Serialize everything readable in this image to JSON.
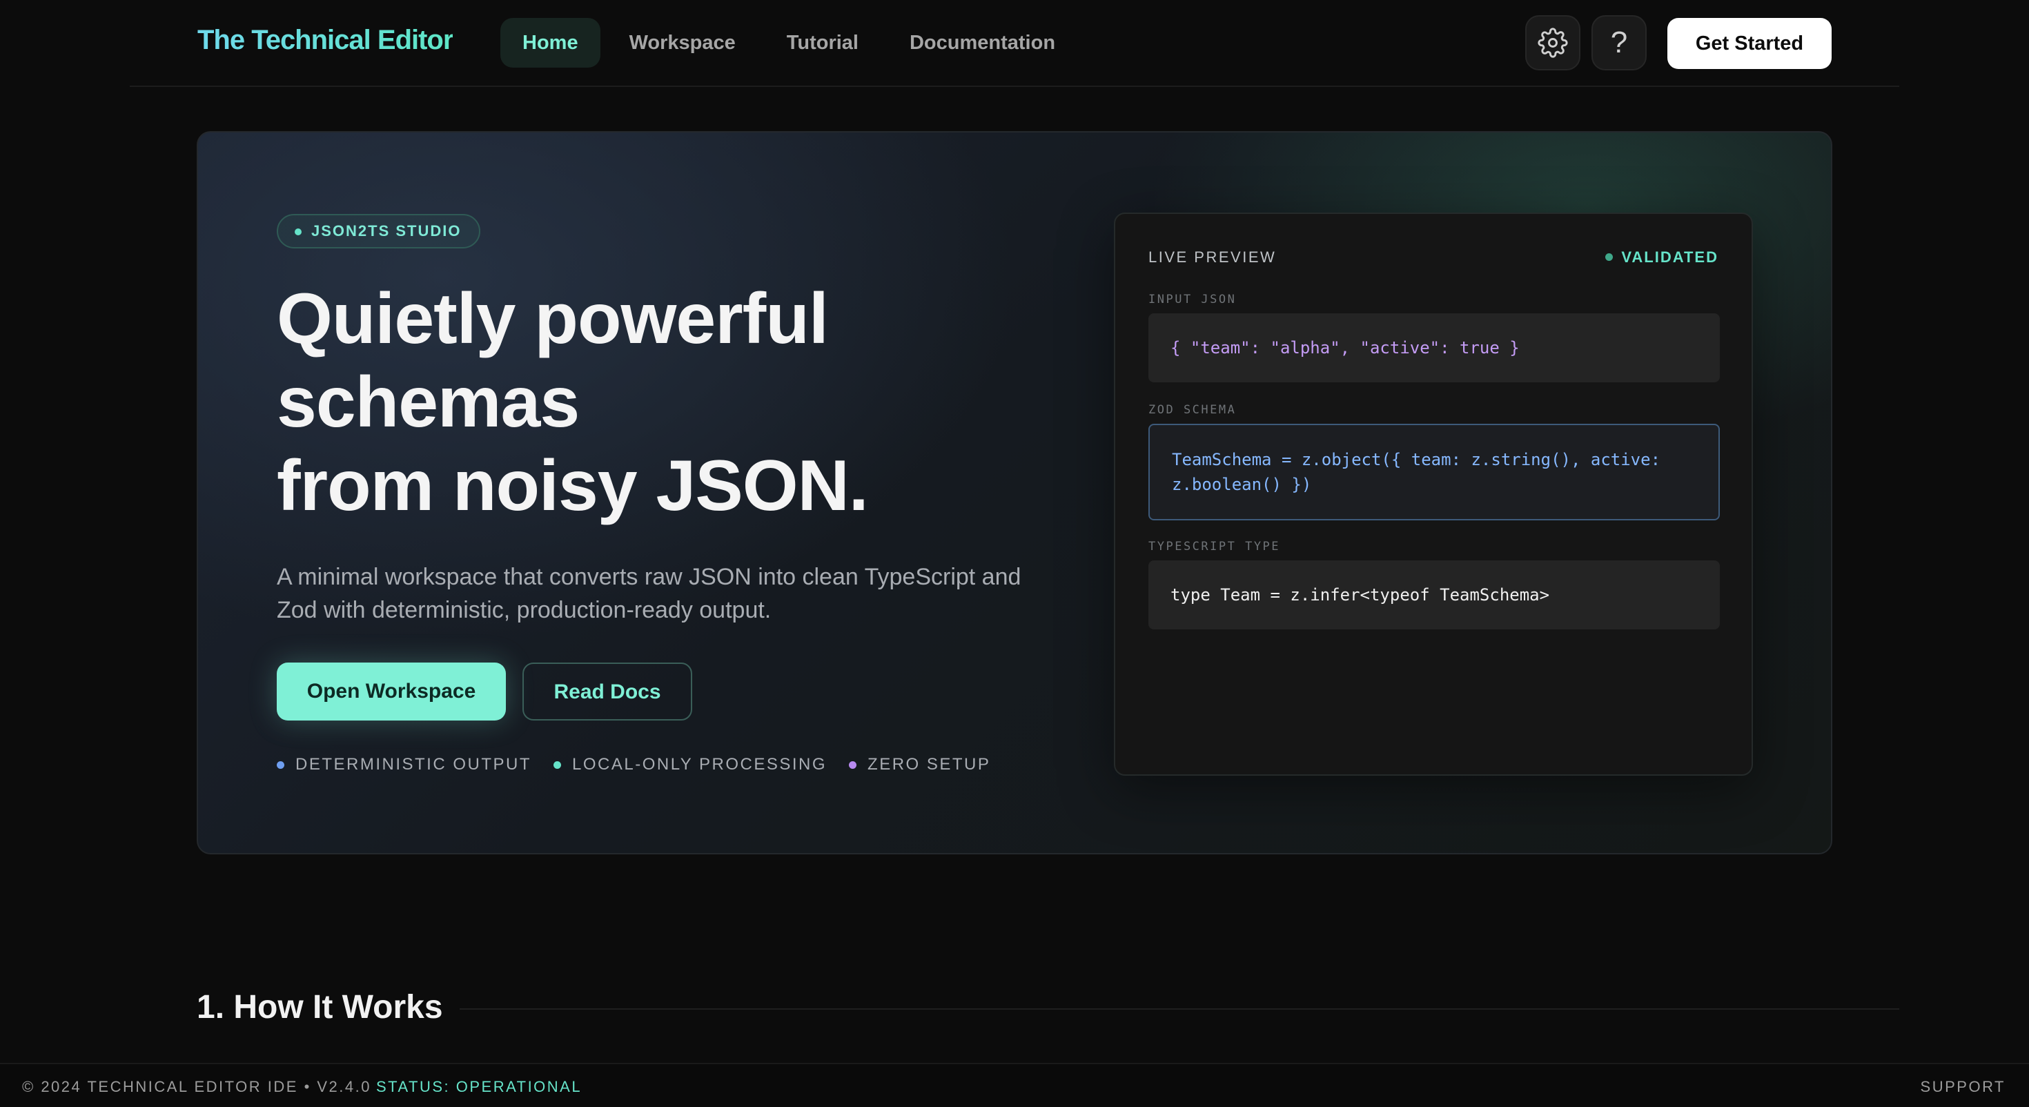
{
  "nav": {
    "brand": "The Technical Editor",
    "links": [
      {
        "label": "Home",
        "active": true
      },
      {
        "label": "Workspace",
        "active": false
      },
      {
        "label": "Tutorial",
        "active": false
      },
      {
        "label": "Documentation",
        "active": false
      }
    ],
    "settings_icon": "gear-icon",
    "help_icon": "question-icon",
    "help_glyph": "?",
    "cta_label": "Get Started"
  },
  "hero": {
    "badge": "JSON2TS STUDIO",
    "title_lines": [
      "Quietly powerful",
      "schemas",
      "from noisy JSON."
    ],
    "description": "A minimal workspace that converts raw JSON into clean TypeScript and Zod with deterministic, production-ready output.",
    "primary_button": "Open Workspace",
    "secondary_button": "Read Docs",
    "features": [
      {
        "label": "DETERMINISTIC OUTPUT",
        "color": "#6f9ff0"
      },
      {
        "label": "LOCAL-ONLY PROCESSING",
        "color": "#66e3c9"
      },
      {
        "label": "ZERO SETUP",
        "color": "#b88af0"
      }
    ]
  },
  "preview": {
    "title": "LIVE PREVIEW",
    "status": "VALIDATED",
    "input_label": "INPUT JSON",
    "input_code": "{ \"team\": \"alpha\", \"active\": true }",
    "zod_label": "ZOD SCHEMA",
    "zod_code": "TeamSchema = z.object({ team: z.string(), active: z.boolean() })",
    "ts_label": "TYPESCRIPT TYPE",
    "ts_code": "type Team = z.infer<typeof TeamSchema>"
  },
  "section": {
    "title": "1. How It Works"
  },
  "footer": {
    "copyright": "© 2024 TECHNICAL EDITOR IDE • V2.4.0",
    "status": "STATUS: OPERATIONAL",
    "support": "SUPPORT"
  },
  "colors": {
    "accent": "#7ff0d6",
    "background": "#0c0c0c"
  }
}
